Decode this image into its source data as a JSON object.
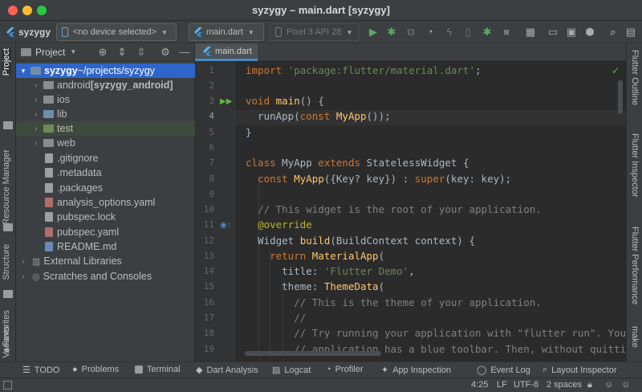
{
  "window": {
    "title": "syzygy – main.dart [syzygy]"
  },
  "toolbar": {
    "project_name": "syzygy",
    "device_selector": "<no device selected>",
    "run_config": "main.dart",
    "emulator": "Pixel 3 API 28"
  },
  "left_tabs": [
    "Project",
    "Resource Manager",
    "Structure",
    "Favorites",
    "Variants"
  ],
  "right_tabs": [
    "Flutter Outline",
    "Flutter Inspector",
    "Flutter Performance",
    "make"
  ],
  "project_panel": {
    "title": "Project",
    "tree": [
      {
        "name": "syzygy",
        "suffix": " ~/projects/syzygy",
        "type": "root"
      },
      {
        "name": "android",
        "suffix": " [syzygy_android]",
        "type": "folder"
      },
      {
        "name": "ios",
        "suffix": "",
        "type": "folder"
      },
      {
        "name": "lib",
        "suffix": "",
        "type": "folder"
      },
      {
        "name": "test",
        "suffix": "",
        "type": "folder"
      },
      {
        "name": "web",
        "suffix": "",
        "type": "folder"
      },
      {
        "name": ".gitignore",
        "suffix": "",
        "type": "file"
      },
      {
        "name": ".metadata",
        "suffix": "",
        "type": "file"
      },
      {
        "name": ".packages",
        "suffix": "",
        "type": "file"
      },
      {
        "name": "analysis_options.yaml",
        "suffix": "",
        "type": "yaml"
      },
      {
        "name": "pubspec.lock",
        "suffix": "",
        "type": "file"
      },
      {
        "name": "pubspec.yaml",
        "suffix": "",
        "type": "yaml"
      },
      {
        "name": "README.md",
        "suffix": "",
        "type": "md"
      },
      {
        "name": "External Libraries",
        "suffix": "",
        "type": "lib"
      },
      {
        "name": "Scratches and Consoles",
        "suffix": "",
        "type": "scratch"
      }
    ]
  },
  "editor": {
    "tab_label": "main.dart",
    "line_numbers": [
      "1",
      "2",
      "3",
      "4",
      "5",
      "6",
      "7",
      "8",
      "9",
      "10",
      "11",
      "12",
      "13",
      "14",
      "15",
      "16",
      "17",
      "18",
      "19"
    ],
    "current_line": 4
  },
  "bottom_tools": [
    "TODO",
    "Problems",
    "Terminal",
    "Dart Analysis",
    "Logcat",
    "Profiler",
    "App Inspection",
    "Event Log",
    "Layout Inspector"
  ],
  "status": {
    "position": "4:25",
    "line_sep": "LF",
    "encoding": "UTF-8",
    "indent": "2 spaces"
  }
}
